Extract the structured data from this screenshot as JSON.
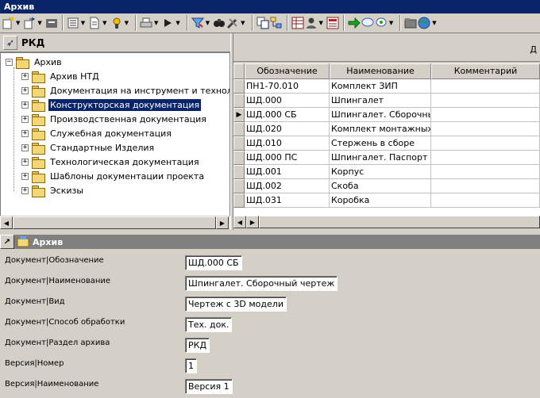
{
  "window": {
    "title": "Архив"
  },
  "tree_panel": {
    "header": "РКД",
    "root": "Архив",
    "items": [
      {
        "label": "Архив НТД"
      },
      {
        "label": "Документация на инструмент и технологию"
      },
      {
        "label": "Конструкторская документация",
        "selected": true
      },
      {
        "label": "Производственная документация"
      },
      {
        "label": "Служебная документация"
      },
      {
        "label": "Стандартные Изделия"
      },
      {
        "label": "Технологическая документация"
      },
      {
        "label": "Шаблоны документации проекта"
      },
      {
        "label": "Эскизы"
      }
    ]
  },
  "grid": {
    "hint": "Д",
    "columns": [
      "Обозначение",
      "Наименование",
      "Комментарий"
    ],
    "rows": [
      {
        "code": "ПН1-70.010",
        "name": "Комплект ЗИП",
        "comment": ""
      },
      {
        "code": "ШД.000",
        "name": "Шпингалет",
        "comment": ""
      },
      {
        "code": "ШД.000 СБ",
        "name": "Шпингалет. Сборочный чертеж",
        "comment": "",
        "current": true
      },
      {
        "code": "ШД.020",
        "name": "Комплект монтажных частей",
        "comment": ""
      },
      {
        "code": "ШД.010",
        "name": "Стержень в сборе",
        "comment": ""
      },
      {
        "code": "ШД.000 ПС",
        "name": "Шпингалет. Паспорт",
        "comment": ""
      },
      {
        "code": "ШД.001",
        "name": "Корпус",
        "comment": ""
      },
      {
        "code": "ШД.002",
        "name": "Скоба",
        "comment": ""
      },
      {
        "code": "ШД.031",
        "name": "Коробка",
        "comment": ""
      }
    ]
  },
  "properties": {
    "header": "Архив",
    "fields": [
      {
        "label": "Документ|Обозначение",
        "value": "ШД.000 СБ"
      },
      {
        "label": "Документ|Наименование",
        "value": "Шпингалет. Сборочный чертеж"
      },
      {
        "label": "Документ|Вид",
        "value": "Чертеж с 3D модели"
      },
      {
        "label": "Документ|Способ обработки",
        "value": "Тех. док."
      },
      {
        "label": "Документ|Раздел архива",
        "value": "РКД"
      },
      {
        "label": "Версия|Номер",
        "value": "1"
      },
      {
        "label": "Версия|Наименование",
        "value": "Версия 1"
      }
    ]
  },
  "toolbar_icons": [
    "new-doc-icon",
    "transfer-icon",
    "list-icon",
    "document-icon",
    "lock-icon",
    "print-icon",
    "run-icon",
    "filter-icon",
    "find-icon",
    "tools-icon",
    "copy-icon",
    "tree-icon",
    "table-icon",
    "user-icon",
    "report-icon",
    "arrow-right-icon",
    "chat-icon",
    "refresh-icon",
    "folder-icon",
    "globe-icon"
  ]
}
